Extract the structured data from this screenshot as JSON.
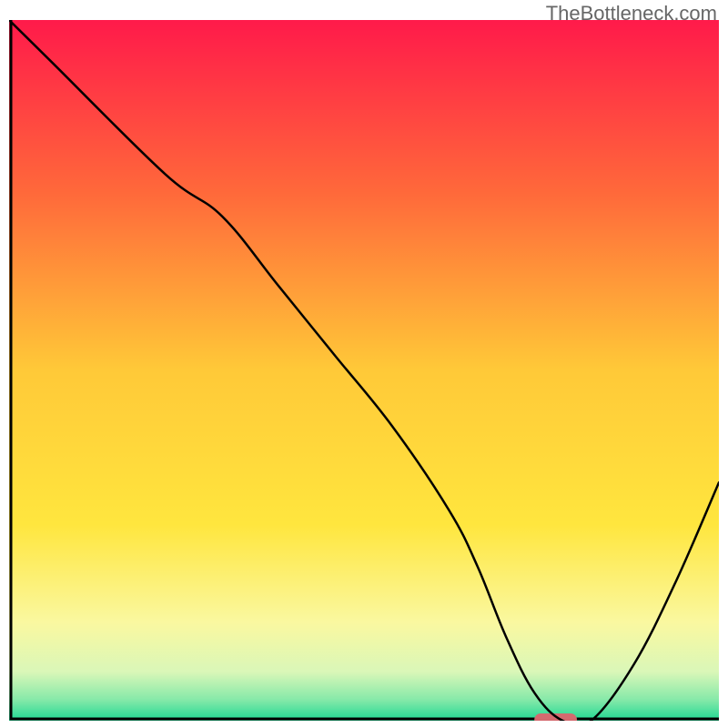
{
  "watermark": "TheBottleneck.com",
  "chart_data": {
    "type": "line",
    "title": "",
    "xlabel": "",
    "ylabel": "",
    "xlim": [
      0,
      100
    ],
    "ylim": [
      0,
      100
    ],
    "gradient_stops": [
      {
        "offset": 0.0,
        "color": "#ff1a4a"
      },
      {
        "offset": 0.25,
        "color": "#ff6a3a"
      },
      {
        "offset": 0.5,
        "color": "#ffc938"
      },
      {
        "offset": 0.72,
        "color": "#ffe63e"
      },
      {
        "offset": 0.86,
        "color": "#faf8a0"
      },
      {
        "offset": 0.93,
        "color": "#daf7b8"
      },
      {
        "offset": 0.97,
        "color": "#86e9a9"
      },
      {
        "offset": 1.0,
        "color": "#1fd893"
      }
    ],
    "curve": {
      "x": [
        0,
        6,
        22,
        30,
        38,
        46,
        54,
        62,
        66,
        70,
        74,
        78,
        82,
        88,
        94,
        100
      ],
      "y": [
        100,
        94,
        78,
        72,
        62,
        52,
        42,
        30,
        22,
        12,
        4,
        0,
        0,
        8,
        20,
        34
      ]
    },
    "marker": {
      "x_start": 74,
      "x_end": 80,
      "y": 0,
      "color": "#d46a6f"
    },
    "axes_color": "#000000"
  }
}
